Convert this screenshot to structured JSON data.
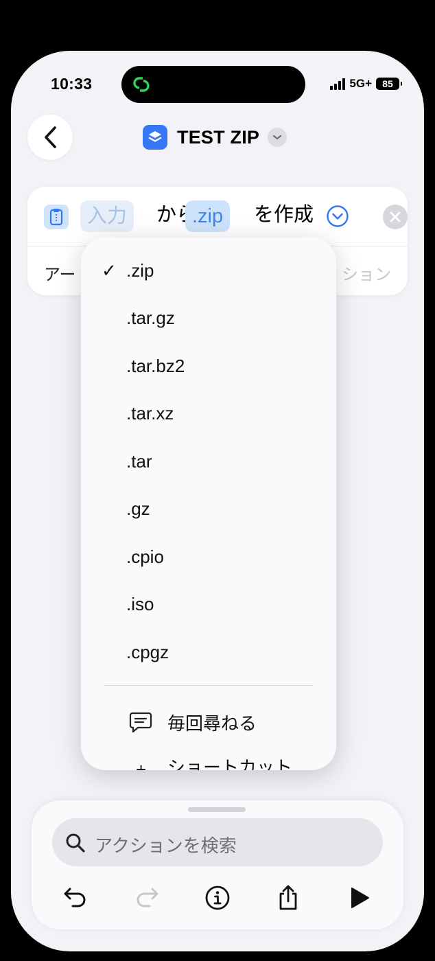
{
  "status_bar": {
    "time": "10:33",
    "network": "5G+",
    "battery": "85"
  },
  "header": {
    "title": "TEST ZIP"
  },
  "action": {
    "input_token": "入力",
    "from_text": "から",
    "format_token": ".zip",
    "create_text": "を作成",
    "row2_left": "アー",
    "row2_right": "ション"
  },
  "menu": {
    "selected": ".zip",
    "items": [
      ".zip",
      ".tar.gz",
      ".tar.bz2",
      ".tar.xz",
      ".tar",
      ".gz",
      ".cpio",
      ".iso",
      ".cpgz"
    ],
    "ask_each_time": "毎回尋ねる",
    "shortcut_input": "ショートカット"
  },
  "search": {
    "placeholder": "アクションを検索"
  },
  "colors": {
    "accent": "#3478f6",
    "token_blue": "#3d86ee",
    "background": "#f2f2f7"
  }
}
